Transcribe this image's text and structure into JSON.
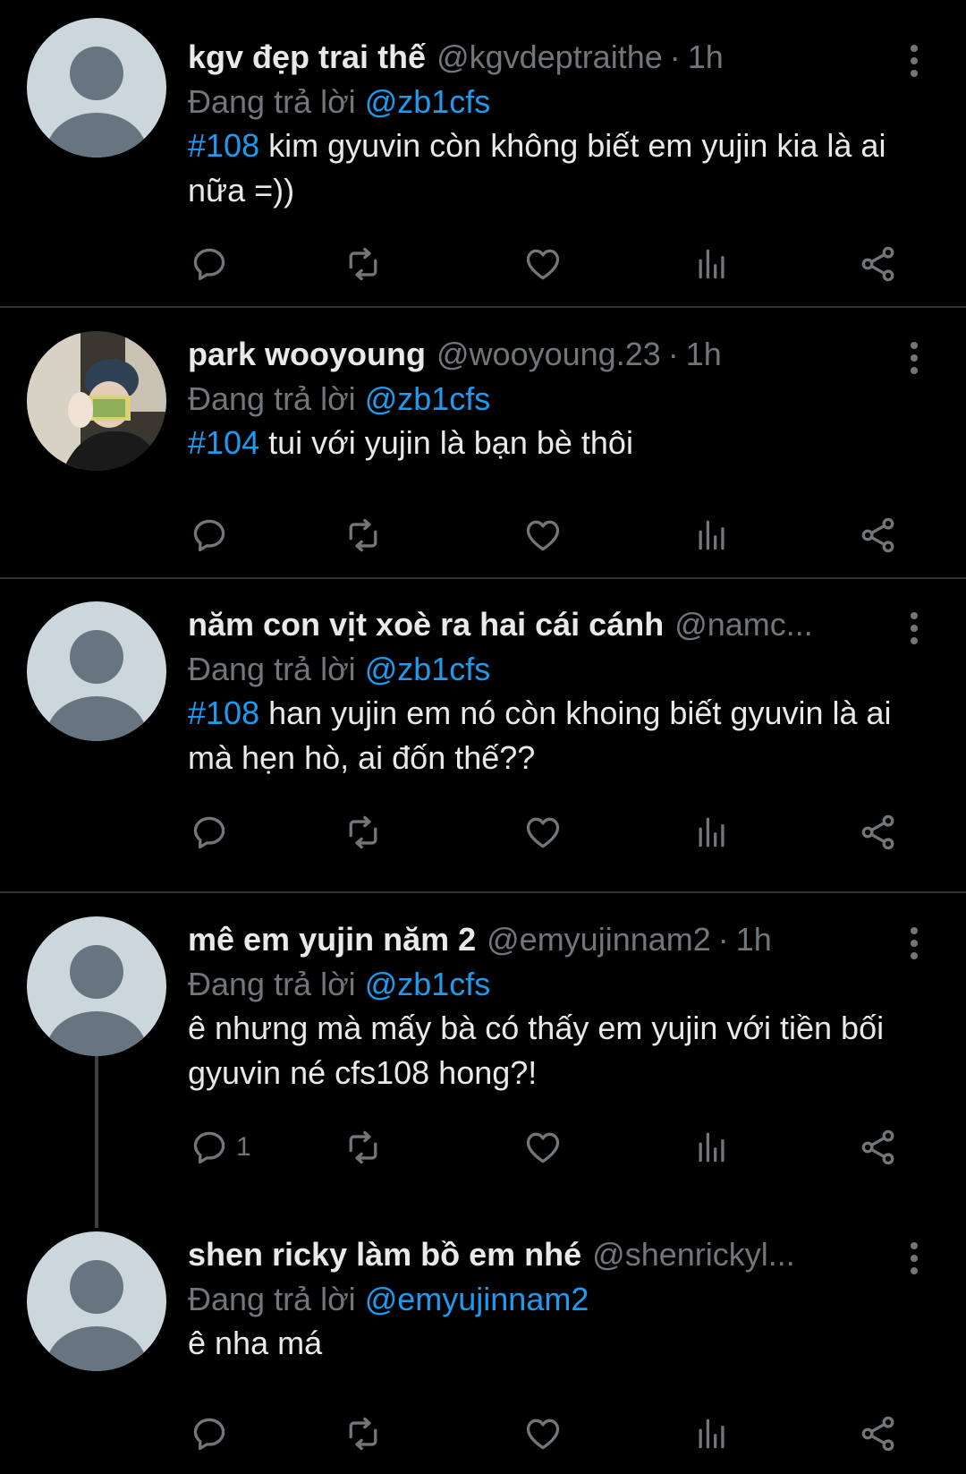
{
  "tweets": [
    {
      "name": "kgv đẹp trai thế",
      "handle": "@kgvdeptraithe",
      "time": "1h",
      "reply_prefix": "Đang trả lời",
      "reply_to": "@zb1cfs",
      "hashtag": "#108",
      "text": " kim gyuvin còn không biết em yujin kia là ai nữa =))",
      "reply_count": ""
    },
    {
      "name": "park wooyoung",
      "handle": "@wooyoung.23",
      "time": "1h",
      "reply_prefix": "Đang trả lời",
      "reply_to": "@zb1cfs",
      "hashtag": "#104",
      "text": " tui với yujin là bạn bè thôi",
      "reply_count": ""
    },
    {
      "name": "năm con vịt xoè ra hai cái cánh",
      "handle": "@namc...",
      "time": "",
      "reply_prefix": "Đang trả lời",
      "reply_to": "@zb1cfs",
      "hashtag": "#108",
      "text": " han yujin em nó còn khoing biết gyuvin là ai mà hẹn hò, ai đốn thế??",
      "reply_count": ""
    },
    {
      "name": "mê em yujin năm 2",
      "handle": "@emyujinnam2",
      "time": "1h",
      "reply_prefix": "Đang trả lời",
      "reply_to": "@zb1cfs",
      "hashtag": "",
      "text": "ê nhưng mà mấy bà có thấy em yujin với tiền bối gyuvin né cfs108 hong?!",
      "reply_count": "1"
    },
    {
      "name": "shen ricky làm bồ em nhé",
      "handle": "@shenrickyl...",
      "time": "",
      "reply_prefix": "Đang trả lời",
      "reply_to": "@emyujinnam2",
      "hashtag": "",
      "text": "ê nha má",
      "reply_count": ""
    }
  ],
  "icons": {
    "reply": "reply-icon",
    "retweet": "retweet-icon",
    "like": "heart-icon",
    "views": "views-icon",
    "share": "share-icon",
    "more": "more-vertical-icon",
    "avatar_default": "default-avatar-icon"
  },
  "colors": {
    "background": "#000000",
    "text": "#e7e9ea",
    "muted": "#71767b",
    "accent": "#1d9bf0",
    "divider": "#2f3336",
    "avatar_bg": "#ccd6dd",
    "avatar_fg": "#66757f"
  }
}
